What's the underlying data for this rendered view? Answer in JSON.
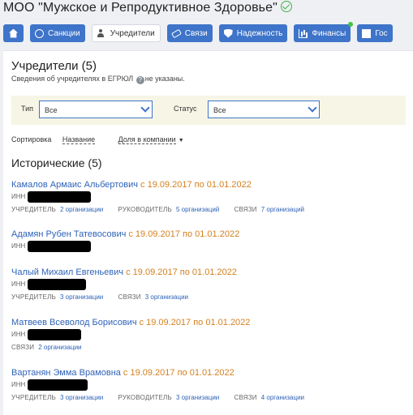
{
  "header": {
    "title": "МОО \"Мужское и Репродуктивное Здоровье\""
  },
  "nav": [
    {
      "label": "",
      "icon": "home-icon"
    },
    {
      "label": "Санкции",
      "icon": "globe-icon"
    },
    {
      "label": "Учредители",
      "icon": "people-icon",
      "active": true
    },
    {
      "label": "Связи",
      "icon": "link-icon"
    },
    {
      "label": "Надежность",
      "icon": "shield-icon"
    },
    {
      "label": "Финансы",
      "icon": "chart-icon"
    },
    {
      "label": "Гос",
      "icon": "document-icon"
    }
  ],
  "section": {
    "title": "Учредители (5)",
    "subtitle_before": "Сведения об учредителях в ЕГРЮЛ",
    "subtitle_after": "не указаны."
  },
  "filters": {
    "type_label": "Тип",
    "type_value": "Все",
    "status_label": "Статус",
    "status_value": "Все"
  },
  "sort": {
    "label": "Сортировка",
    "by_name": "Название",
    "by_share": "Доля в компании"
  },
  "historical": {
    "title": "Исторические (5)",
    "inn_label": "ИНН",
    "entries": [
      {
        "name": "Камалов Армаис Альбертович",
        "dates": "с 19.09.2017 по 01.01.2022",
        "meta": [
          {
            "label": "УЧРЕДИТЕЛЬ",
            "count": "2 организации"
          },
          {
            "label": "РУКОВОДИТЕЛЬ",
            "count": "5 организаций"
          },
          {
            "label": "СВЯЗИ",
            "count": "7 организаций"
          }
        ]
      },
      {
        "name": "Адамян Рубен Татевосович",
        "dates": "с 19.09.2017 по 01.01.2022",
        "meta": []
      },
      {
        "name": "Чалый Михаил Евгеньевич",
        "dates": "с 19.09.2017 по 01.01.2022",
        "meta": [
          {
            "label": "УЧРЕДИТЕЛЬ",
            "count": "3 организации"
          },
          {
            "label": "СВЯЗИ",
            "count": "3 организации"
          }
        ]
      },
      {
        "name": "Матвеев Всеволод Борисович",
        "dates": "с 19.09.2017 по 01.01.2022",
        "meta": [
          {
            "label": "СВЯЗИ",
            "count": "2 организации"
          }
        ]
      },
      {
        "name": "Вартанян Эмма Врамовна",
        "dates": "с 19.09.2017 по 01.01.2022",
        "meta": [
          {
            "label": "УЧРЕДИТЕЛЬ",
            "count": "3 организации"
          },
          {
            "label": "РУКОВОДИТЕЛЬ",
            "count": "3 организации"
          },
          {
            "label": "СВЯЗИ",
            "count": "4 организации"
          }
        ]
      }
    ]
  },
  "colors": {
    "accent": "#3e74c9",
    "link": "#2f63b8",
    "date": "#d4801e",
    "verified": "#47b04b",
    "filter_bg": "#f6f5e6"
  }
}
